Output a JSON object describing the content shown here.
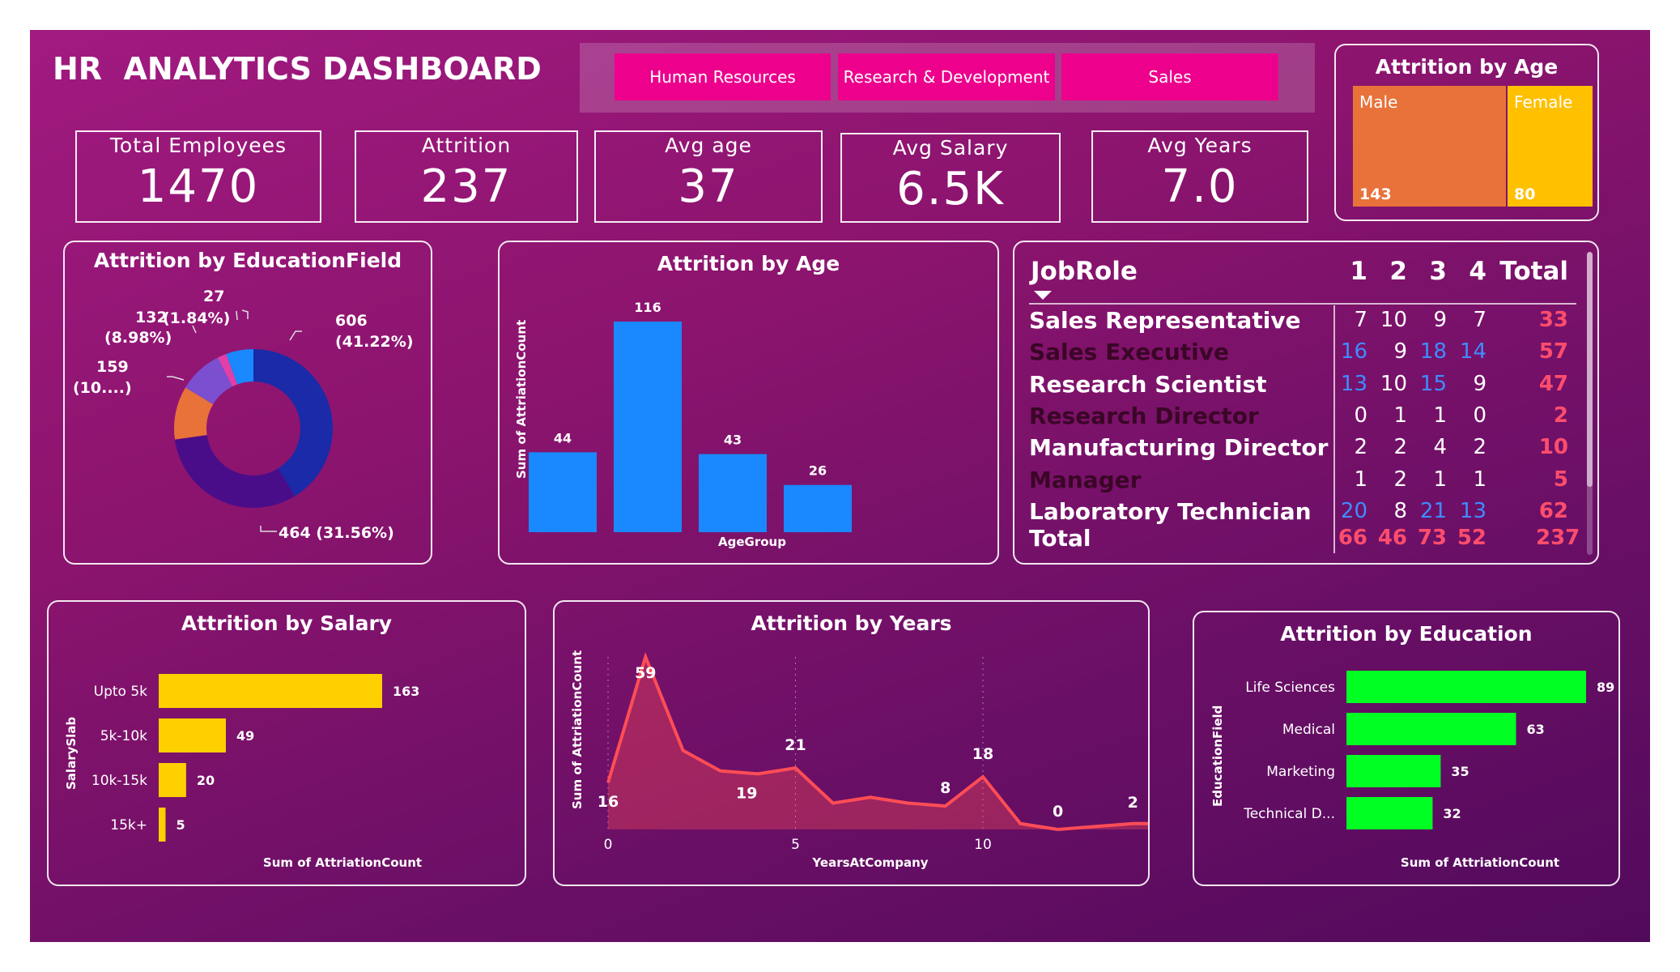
{
  "dashboard": {
    "title": "HR  ANALYTICS DASHBOARD"
  },
  "slicer": {
    "buttons": [
      "Human Resources",
      "Research & Development",
      "Sales"
    ]
  },
  "kpis": [
    {
      "label": "Total Employees",
      "value": "1470"
    },
    {
      "label": "Attrition",
      "value": "237"
    },
    {
      "label": "Avg age",
      "value": "37"
    },
    {
      "label": "Avg Salary",
      "value": "6.5K"
    },
    {
      "label": "Avg Years",
      "value": "7.0"
    }
  ],
  "gender_treemap": {
    "title": "Attrition by Age",
    "items": [
      {
        "label": "Male",
        "value": 143,
        "display": "143",
        "color": "#e8723a"
      },
      {
        "label": "Female",
        "value": 80,
        "display": "80",
        "color": "#ffc000"
      }
    ]
  },
  "education_field_donut": {
    "title": "Attrition by EducationField",
    "labels": {
      "a": {
        "line1": "606",
        "line2": "(41.22%)"
      },
      "b": {
        "line1": "464 (31.56%)"
      },
      "c": {
        "line1": "159",
        "line2": "(10....)"
      },
      "d": {
        "line1": "132",
        "line2": "(8.98%)"
      },
      "e": {
        "line1": "(1.84%)"
      },
      "f": {
        "line1": "27"
      }
    }
  },
  "matrix": {
    "header": {
      "role": "JobRole",
      "cols": [
        "1",
        "2",
        "3",
        "4"
      ],
      "total": "Total"
    },
    "rows": [
      {
        "role": "Sales Representative",
        "vals": [
          "7",
          "10",
          "9",
          "7"
        ],
        "total": "33"
      },
      {
        "role": "Sales Executive",
        "vals": [
          "16",
          "9",
          "18",
          "14"
        ],
        "total": "57"
      },
      {
        "role": "Research Scientist",
        "vals": [
          "13",
          "10",
          "15",
          "9"
        ],
        "total": "47"
      },
      {
        "role": "Research Director",
        "vals": [
          "0",
          "1",
          "1",
          "0"
        ],
        "total": "2"
      },
      {
        "role": "Manufacturing Director",
        "vals": [
          "2",
          "2",
          "4",
          "2"
        ],
        "total": "10"
      },
      {
        "role": "Manager",
        "vals": [
          "1",
          "2",
          "1",
          "1"
        ],
        "total": "5"
      },
      {
        "role": "Laboratory Technician",
        "vals": [
          "20",
          "8",
          "21",
          "13"
        ],
        "total": "62"
      }
    ],
    "total_row": {
      "label": "Total",
      "vals": [
        "66",
        "46",
        "73",
        "52"
      ],
      "total": "237"
    },
    "colors": {
      "high": "#3f8cff",
      "normal": "#ffffff",
      "total": "#ff4d6d"
    }
  },
  "chart_data": [
    {
      "id": "age_bars",
      "type": "bar",
      "title": "Attrition by Age",
      "xlabel": "AgeGroup",
      "ylabel": "Sum of AttriationCount",
      "values": [
        44,
        116,
        43,
        26
      ],
      "ylim": [
        0,
        116
      ],
      "color": "#1a88ff"
    },
    {
      "id": "education_field",
      "type": "pie",
      "title": "Attrition by EducationField",
      "values": [
        606,
        464,
        159,
        132,
        27
      ],
      "colors": [
        "#1a2aa8",
        "#4a0d8a",
        "#e8723a",
        "#7b4fd0",
        "#e040a8",
        "#1a88ff"
      ],
      "extra_slice": 82
    },
    {
      "id": "salary_bars",
      "type": "bar",
      "title": "Attrition by Salary",
      "xlabel": "Sum of AttriationCount",
      "ylabel": "SalarySlab",
      "categories": [
        "Upto 5k",
        "5k-10k",
        "10k-15k",
        "15k+"
      ],
      "values": [
        163,
        49,
        20,
        5
      ],
      "color": "#ffd000"
    },
    {
      "id": "years_area",
      "type": "area",
      "title": "Attrition by Years",
      "xlabel": "YearsAtCompany",
      "ylabel": "Sum of AttriationCount",
      "x": [
        0,
        1,
        2,
        3,
        4,
        5,
        6,
        7,
        8,
        9,
        10,
        11,
        12,
        13,
        14,
        15
      ],
      "y": [
        16,
        59,
        27,
        20,
        19,
        21,
        9,
        11,
        9,
        8,
        18,
        2,
        0,
        1,
        2,
        2
      ],
      "xticks": [
        "0",
        "5",
        "10"
      ],
      "data_labels": [
        {
          "x": 0,
          "text": "16"
        },
        {
          "x": 1,
          "text": "59"
        },
        {
          "x": 4,
          "text": "19"
        },
        {
          "x": 5,
          "text": "21"
        },
        {
          "x": 9,
          "text": "8"
        },
        {
          "x": 10,
          "text": "18"
        },
        {
          "x": 12,
          "text": "0"
        },
        {
          "x": 14,
          "text": "2"
        }
      ],
      "ylim": [
        0,
        59
      ],
      "color": "#ff4d55"
    },
    {
      "id": "education_bars",
      "type": "bar",
      "title": "Attrition by Education",
      "xlabel": "Sum of AttriationCount",
      "ylabel": "EducationField",
      "categories": [
        "Life Sciences",
        "Medical",
        "Marketing",
        "Technical D..."
      ],
      "values": [
        89,
        63,
        35,
        32
      ],
      "color": "#00ff22"
    }
  ]
}
